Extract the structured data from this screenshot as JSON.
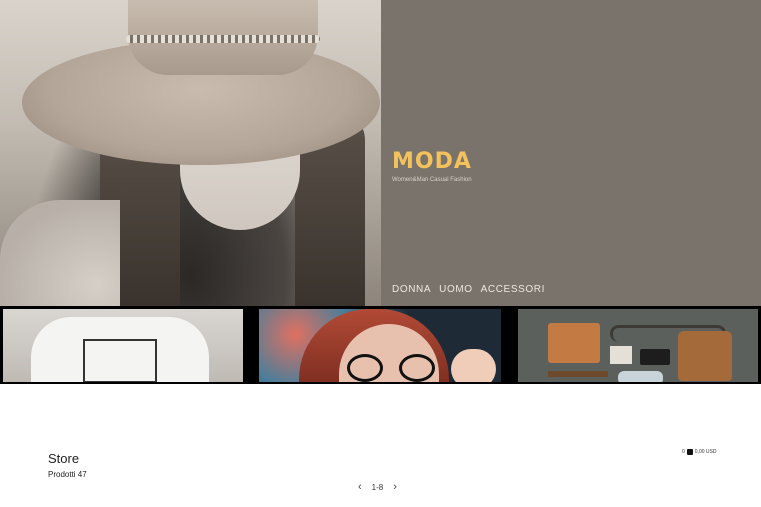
{
  "brand": {
    "title": "MODA",
    "subtitle": "Women&Man Casual Fashion",
    "accent_color": "#f3c25c"
  },
  "nav": {
    "items": [
      "DONNA",
      "UOMO",
      "ACCESSORI"
    ]
  },
  "banners": [
    {
      "icon": "tshirt-photo"
    },
    {
      "icon": "woman-glasses-photo"
    },
    {
      "icon": "accessories-photo"
    }
  ],
  "store": {
    "title": "Store",
    "count_label": "Prodotti 47"
  },
  "cart": {
    "count": "0",
    "total": "0,00 USD"
  },
  "pagination": {
    "range": "1-8",
    "prev_icon": "chevron-left-icon",
    "next_icon": "chevron-right-icon"
  }
}
